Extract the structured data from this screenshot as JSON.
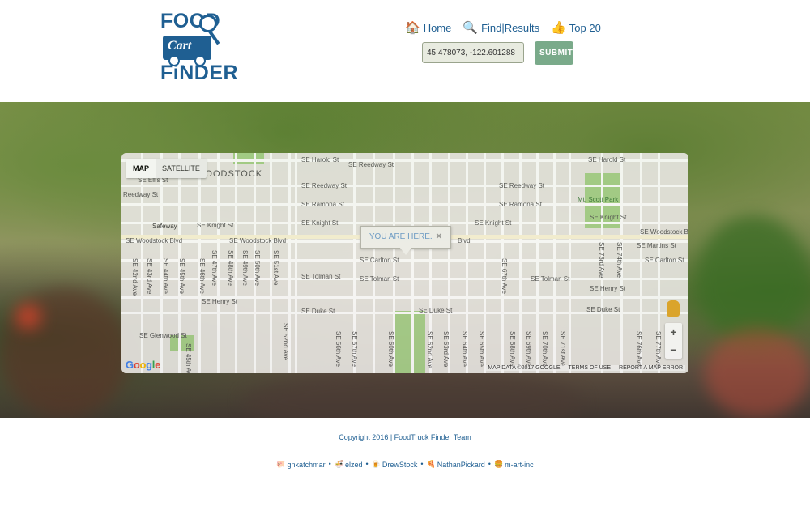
{
  "logo": {
    "line1": "FOOD",
    "cart": "Cart",
    "line2": "FiNDER"
  },
  "nav": [
    {
      "label": "Home",
      "emoji": "🏠"
    },
    {
      "label": "Find|Results",
      "emoji": "🔍"
    },
    {
      "label": "Top 20",
      "emoji": "👍"
    }
  ],
  "search": {
    "value": "45.478073, -122.601288",
    "submit": "SUBMIT"
  },
  "map": {
    "type_map": "MAP",
    "type_satellite": "SATELLITE",
    "you_are_here": "YOU ARE HERE.",
    "close": "✕",
    "zoom_in": "+",
    "zoom_out": "−",
    "google": "Google",
    "attribution": [
      "MAP DATA ©2017 GOOGLE",
      "TERMS OF USE",
      "REPORT A MAP ERROR"
    ],
    "street_labels": [
      "SE Harold St",
      "SE Harold St",
      "SE Ellis St",
      "SE Reedway St",
      "SE Reedway St",
      "SE Reedway St",
      "SE Ramona St",
      "SE Ramona St",
      "SE Knight St",
      "SE Knight St",
      "SE Knight St",
      "SE Knight St",
      "Safeway",
      "WOODSTOCK",
      "SE Woodstock Blvd",
      "SE Woodstock Blvd",
      "SE Woodstock Blvd",
      "Blvd",
      "SE Martins St",
      "SE Carlton St",
      "SE Carlton St",
      "SE Tolman St",
      "SE Tolman St",
      "SE Tolman St",
      "SE Henry St",
      "SE Henry St",
      "SE Duke St",
      "SE Duke St",
      "SE Duke St",
      "SE Glenwood St",
      "Mt. Scott Park",
      "Reedway St",
      "SE 42nd Ave",
      "SE 43rd Ave",
      "SE 44th Ave",
      "SE 45th Ave",
      "SE 46th Ave",
      "SE 47th Ave",
      "SE 48th Ave",
      "SE 49th Ave",
      "SE 50th Ave",
      "SE 51st Ave",
      "SE 52nd Ave",
      "SE 56th Ave",
      "SE 57th Ave",
      "SE 60th Ave",
      "SE 62nd Ave",
      "SE 63rd Ave",
      "SE 64th Ave",
      "SE 65th Ave",
      "SE 67th Ave",
      "SE 68th Ave",
      "SE 69th Ave",
      "SE 70th Ave",
      "SE 71st Ave",
      "SE 73rd Ave",
      "SE 74th Ave",
      "SE 76th Ave",
      "SE 77th Ave",
      "SE 45th Ave"
    ]
  },
  "footer": {
    "copyright": "Copyright 2016 | FoodTruck Finder Team",
    "credits": [
      {
        "name": "gnkatchmar",
        "emoji": "🐖"
      },
      {
        "name": "elzed",
        "emoji": "🍜"
      },
      {
        "name": "DrewStock",
        "emoji": "🍺"
      },
      {
        "name": "NathanPickard",
        "emoji": "🍕"
      },
      {
        "name": "m-art-inc",
        "emoji": "🍔"
      }
    ],
    "separator": "•"
  },
  "colors": {
    "brand": "#1f5f92",
    "submit": "#7aaa8a",
    "input_bg": "#e8ebe0",
    "park": "#a7d08a"
  }
}
